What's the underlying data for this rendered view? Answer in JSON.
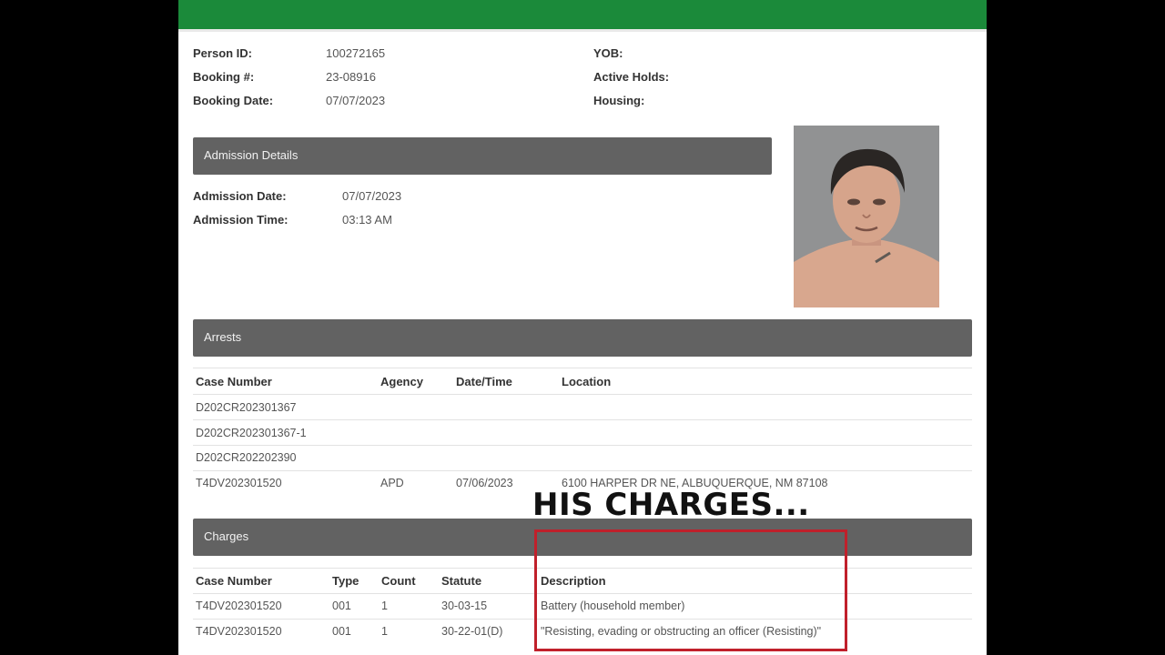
{
  "person": {
    "person_id_label": "Person ID:",
    "person_id": "100272165",
    "booking_num_label": "Booking #:",
    "booking_num": "23-08916",
    "booking_date_label": "Booking Date:",
    "booking_date": "07/07/2023",
    "yob_label": "YOB:",
    "active_holds_label": "Active Holds:",
    "housing_label": "Housing:"
  },
  "admission": {
    "section_title": "Admission Details",
    "date_label": "Admission Date:",
    "date": "07/07/2023",
    "time_label": "Admission Time:",
    "time": "03:13 AM"
  },
  "arrests": {
    "section_title": "Arrests",
    "columns": [
      "Case Number",
      "Agency",
      "Date/Time",
      "Location"
    ],
    "rows": [
      [
        "D202CR202301367",
        "",
        "",
        ""
      ],
      [
        "D202CR202301367-1",
        "",
        "",
        ""
      ],
      [
        "D202CR202202390",
        "",
        "",
        ""
      ],
      [
        "T4DV202301520",
        "APD",
        "07/06/2023",
        "6100 HARPER DR NE, ALBUQUERQUE, NM 87108"
      ]
    ]
  },
  "charges": {
    "section_title": "Charges",
    "columns": [
      "Case Number",
      "Type",
      "Count",
      "Statute",
      "Description"
    ],
    "rows": [
      [
        "T4DV202301520",
        "001",
        "1",
        "30-03-15",
        "Battery (household member)"
      ],
      [
        "T4DV202301520",
        "001",
        "1",
        "30-22-01(D)",
        "\"Resisting, evading or obstructing an officer (Resisting)\""
      ]
    ]
  },
  "overlay": {
    "caption": "HIS CHARGES...",
    "highlight_color": "#c0202b"
  },
  "colors": {
    "header_green": "#1b8a3a",
    "section_bar": "#626262"
  }
}
